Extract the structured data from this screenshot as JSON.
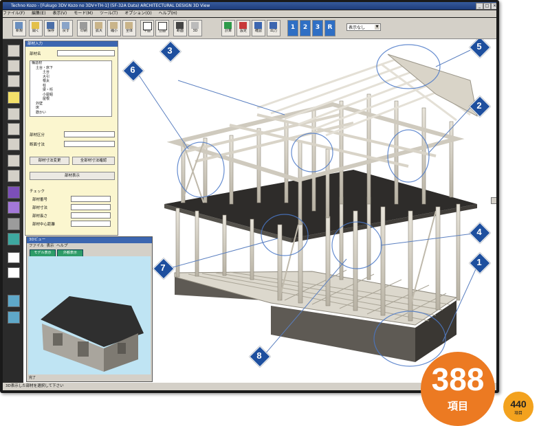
{
  "window": {
    "title": "Techno Kozo - [Fukugo 3DV Kozo no 3DV+TH-1] (5F-32A Data)  ARCHITECTURAL DESIGN 3D View",
    "buttons": [
      "_",
      "□",
      "×"
    ]
  },
  "menu": [
    "ファイル(F)",
    "編集(E)",
    "表示(V)",
    "モード(M)",
    "ツール(T)",
    "オプション(O)",
    "ヘルプ(H)"
  ],
  "toolbar": {
    "buttons": [
      "新規",
      "開く",
      "保存",
      "戻す",
      "印刷",
      "拡大",
      "縮小",
      "全体",
      "平面",
      "立面",
      "断面",
      "3D",
      "計算",
      "設定",
      "確認",
      "出力"
    ],
    "floors": [
      "1",
      "2",
      "3",
      "R"
    ],
    "view_select": "表示なし"
  },
  "panel": {
    "title": "部材入力",
    "label_name": "部材名",
    "tree": [
      "構造材",
      "土台・床下",
      "土台",
      "大引",
      "根太",
      "柱",
      "梁・桁",
      "小屋組",
      "屋根",
      "外壁",
      "床",
      "筋かい",
      "その他"
    ],
    "label_kind": "部材区分",
    "label_cut": "断面寸法",
    "btn_change": "部材寸法変更",
    "btn_all": "全部材寸法確認",
    "btn_display": "部材表示",
    "section_title": "チェック",
    "rows": [
      "部材番号",
      "部材寸法",
      "部材長さ",
      "部材中心距離"
    ]
  },
  "subwindow": {
    "title": "3Dビュー",
    "menu": [
      "ファイル",
      "表示",
      "ヘルプ"
    ],
    "btn1": "モデル表示",
    "btn2": "外観表示",
    "status": "完了"
  },
  "status_bar": "3D表示した部材を選択して下さい",
  "callouts": [
    "1",
    "2",
    "3",
    "4",
    "5",
    "6",
    "7",
    "8"
  ],
  "badge": {
    "count": "388",
    "unit": "項目"
  },
  "badge_small": {
    "count": "440",
    "unit": "項目"
  },
  "colors": {
    "accent": "#1e4f9e",
    "badge": "#ec7a22",
    "badge_small": "#f3a21e"
  }
}
